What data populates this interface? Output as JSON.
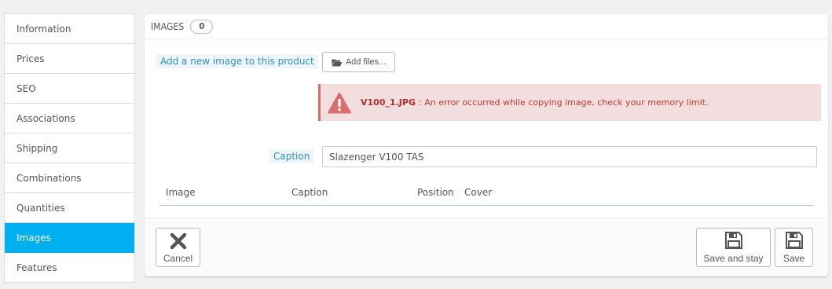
{
  "sidebar": {
    "items": [
      {
        "label": "Information"
      },
      {
        "label": "Prices"
      },
      {
        "label": "SEO"
      },
      {
        "label": "Associations"
      },
      {
        "label": "Shipping"
      },
      {
        "label": "Combinations"
      },
      {
        "label": "Quantities"
      },
      {
        "label": "Images",
        "active": true
      },
      {
        "label": "Features"
      }
    ]
  },
  "panel": {
    "title": "IMAGES",
    "count": "0",
    "add_image_label": "Add a new image to this product",
    "add_files_button": "Add files...",
    "error": {
      "file": "V100_1.JPG",
      "message": ": An error occurred while copying image, check your memory limit."
    },
    "caption_label": "Caption",
    "caption_value": "Slazenger V100 TAS",
    "table_headers": [
      "Image",
      "Caption",
      "Position",
      "Cover"
    ]
  },
  "footer": {
    "cancel_label": "Cancel",
    "save_and_stay_label": "Save and stay",
    "save_label": "Save"
  },
  "colors": {
    "accent": "#00aff0",
    "error_bg": "#f2dede",
    "error_text": "#c0392b",
    "label_blue": "#2e8fbe"
  },
  "icons": {
    "folder": "folder-open-icon",
    "warning": "warning-icon",
    "cancel": "close-icon",
    "save": "floppy-disk-icon"
  }
}
